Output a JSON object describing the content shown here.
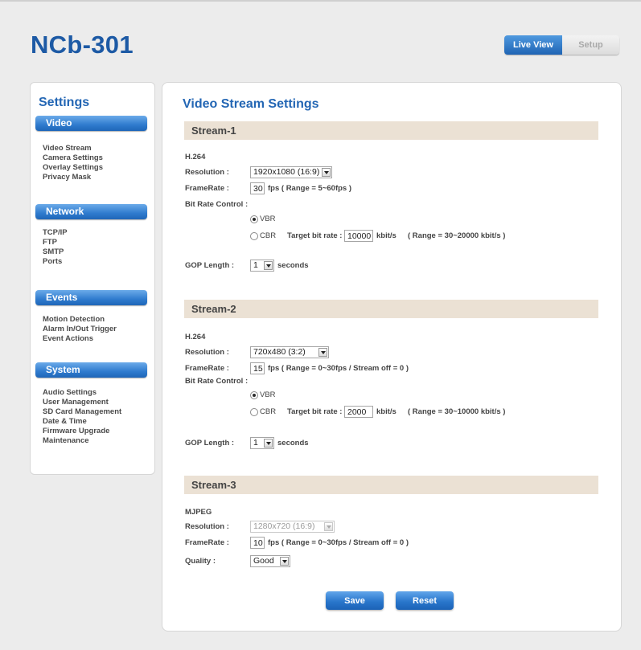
{
  "app": {
    "title": "NCb-301"
  },
  "top_nav": {
    "live_view": "Live View",
    "setup": "Setup"
  },
  "sidebar": {
    "title": "Settings",
    "categories": [
      {
        "label": "Video",
        "items": [
          "Video Stream",
          "Camera Settings",
          "Overlay Settings",
          "Privacy Mask"
        ]
      },
      {
        "label": "Network",
        "items": [
          "TCP/IP",
          "FTP",
          "SMTP",
          "Ports"
        ]
      },
      {
        "label": "Events",
        "items": [
          "Motion Detection",
          "Alarm In/Out Trigger",
          "Event Actions"
        ]
      },
      {
        "label": "System",
        "items": [
          "Audio Settings",
          "User Management",
          "SD Card Management",
          "Date & Time",
          "Firmware Upgrade",
          "Maintenance"
        ]
      }
    ]
  },
  "main": {
    "title": "Video Stream Settings",
    "labels": {
      "resolution": "Resolution :",
      "framerate": "FrameRate :",
      "bit_rate_control": "Bit Rate Control :",
      "vbr": "VBR",
      "cbr": "CBR",
      "target_bit_rate": "Target bit rate :",
      "kbits": "kbit/s",
      "gop_length": "GOP Length :",
      "seconds": "seconds",
      "quality": "Quality :"
    },
    "stream1": {
      "header": "Stream-1",
      "codec": "H.264",
      "resolution": "1920x1080 (16:9)",
      "framerate": "30",
      "fps_range": "fps ( Range = 5~60fps )",
      "bitrate_mode": "VBR",
      "target_bit_rate": "10000",
      "bit_range": "( Range = 30~20000 kbit/s )",
      "gop": "1"
    },
    "stream2": {
      "header": "Stream-2",
      "codec": "H.264",
      "resolution": "720x480 (3:2)",
      "framerate": "15",
      "fps_range": "fps ( Range = 0~30fps / Stream off = 0 )",
      "bitrate_mode": "VBR",
      "target_bit_rate": "2000",
      "bit_range": "( Range = 30~10000 kbit/s )",
      "gop": "1"
    },
    "stream3": {
      "header": "Stream-3",
      "codec": "MJPEG",
      "resolution": "1280x720 (16:9)",
      "framerate": "10",
      "fps_range": "fps ( Range = 0~30fps / Stream off = 0 )",
      "quality": "Good"
    },
    "buttons": {
      "save": "Save",
      "reset": "Reset"
    }
  }
}
